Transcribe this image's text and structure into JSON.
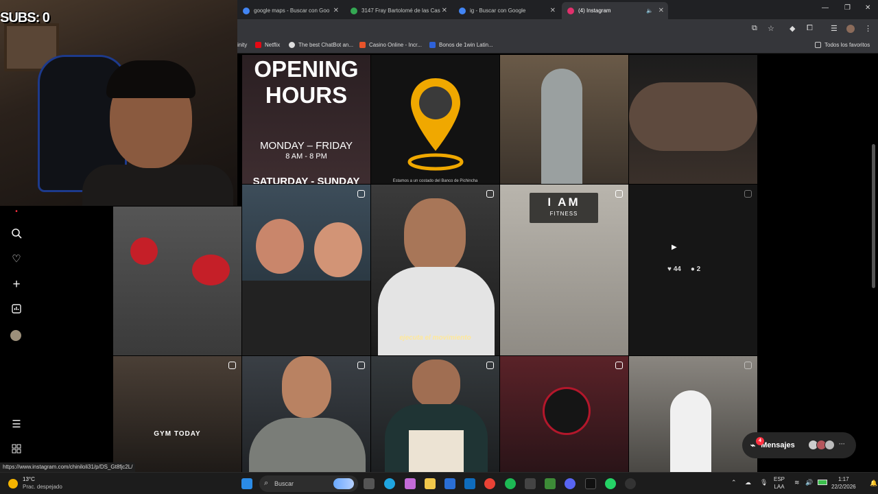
{
  "webcam": {
    "overlay": "SUBS: 0"
  },
  "browser": {
    "tabs": [
      {
        "label": "google maps - Buscar con Goo",
        "color": "#4285f4"
      },
      {
        "label": "3147 Fray Bartolomé de las Cas",
        "color": "#34a853"
      },
      {
        "label": "ig - Buscar con Google",
        "color": "#4285f4"
      },
      {
        "label": "(4) Instagram",
        "color": "#e1306c"
      }
    ],
    "bookmarks": [
      "inity",
      "Netflix",
      "The best ChatBot an...",
      "Casino Online - Incr...",
      "Bonos de 1win Latin...",
      "Todos los favoritos"
    ]
  },
  "grid": {
    "row1": [
      "OPENING HOURS",
      "MONDAY – FRIDAY",
      "8 AM - 8 PM",
      "SATURDAY - SUNDAY",
      "Estamos a un costado del Banco de Pichincha"
    ],
    "row2": {
      "fitness_sign_top": "I AM",
      "fitness_sign_bottom": "FITNESS",
      "subtitle": "ejecuta el movimiento",
      "likes": "44",
      "comments": "2"
    },
    "row3": {
      "gym_today": "GYM TODAY"
    }
  },
  "messages": {
    "label": "Mensajes",
    "count": "4"
  },
  "status_url": "https://www.instagram.com/chiniloli31/p/DS_Gt8fjc2L/",
  "taskbar": {
    "weather_temp": "13°C",
    "weather_desc": "Prac. despejado",
    "search_placeholder": "Buscar",
    "lang": "ESP",
    "lang2": "LAA",
    "time": "1:17",
    "date": "22/2/2026"
  }
}
